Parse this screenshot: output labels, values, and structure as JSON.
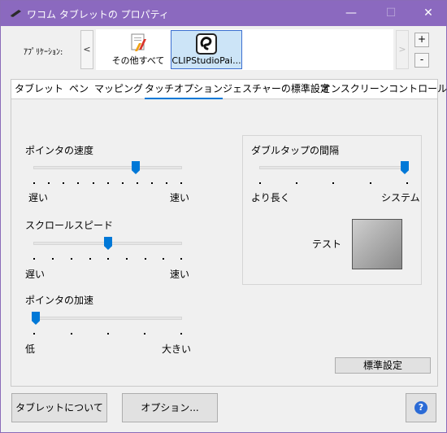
{
  "window": {
    "title": "ワコム タブレットの プロパティ",
    "minimize": "—",
    "maximize": "☐",
    "close": "✕"
  },
  "appbar": {
    "label": "ｱﾌﾟﾘｹｰｼｮﾝ:",
    "scroll_left": "<",
    "scroll_right": ">",
    "add": "+",
    "remove": "-",
    "apps": [
      {
        "label": "その他すべて"
      },
      {
        "label": "CLIPStudioPai..."
      }
    ]
  },
  "tabs": [
    {
      "label": "タブレット"
    },
    {
      "label": "ペン"
    },
    {
      "label": "マッピング"
    },
    {
      "label": "タッチオプション"
    },
    {
      "label": "ジェスチャーの標準設定"
    },
    {
      "label": "オンスクリーンコントロール"
    }
  ],
  "touch": {
    "pointer_speed": {
      "label": "ポインタの速度",
      "min_label": "遅い",
      "max_label": "速い",
      "value": 0.7
    },
    "scroll_speed": {
      "label": "スクロールスピード",
      "min_label": "遅い",
      "max_label": "速い",
      "value": 0.5
    },
    "pointer_accel": {
      "label": "ポインタの加速",
      "min_label": "低",
      "max_label": "大きい",
      "value": 0.0
    },
    "double_tap": {
      "label": "ダブルタップの間隔",
      "min_label": "より長く",
      "max_label": "システム",
      "value": 1.0
    },
    "test_label": "テスト",
    "default_button": "標準設定"
  },
  "footer": {
    "about": "タブレットについて",
    "options": "オプション...",
    "help": "?"
  },
  "colors": {
    "titlebar": "#8b69bf",
    "accent": "#0078d7"
  }
}
